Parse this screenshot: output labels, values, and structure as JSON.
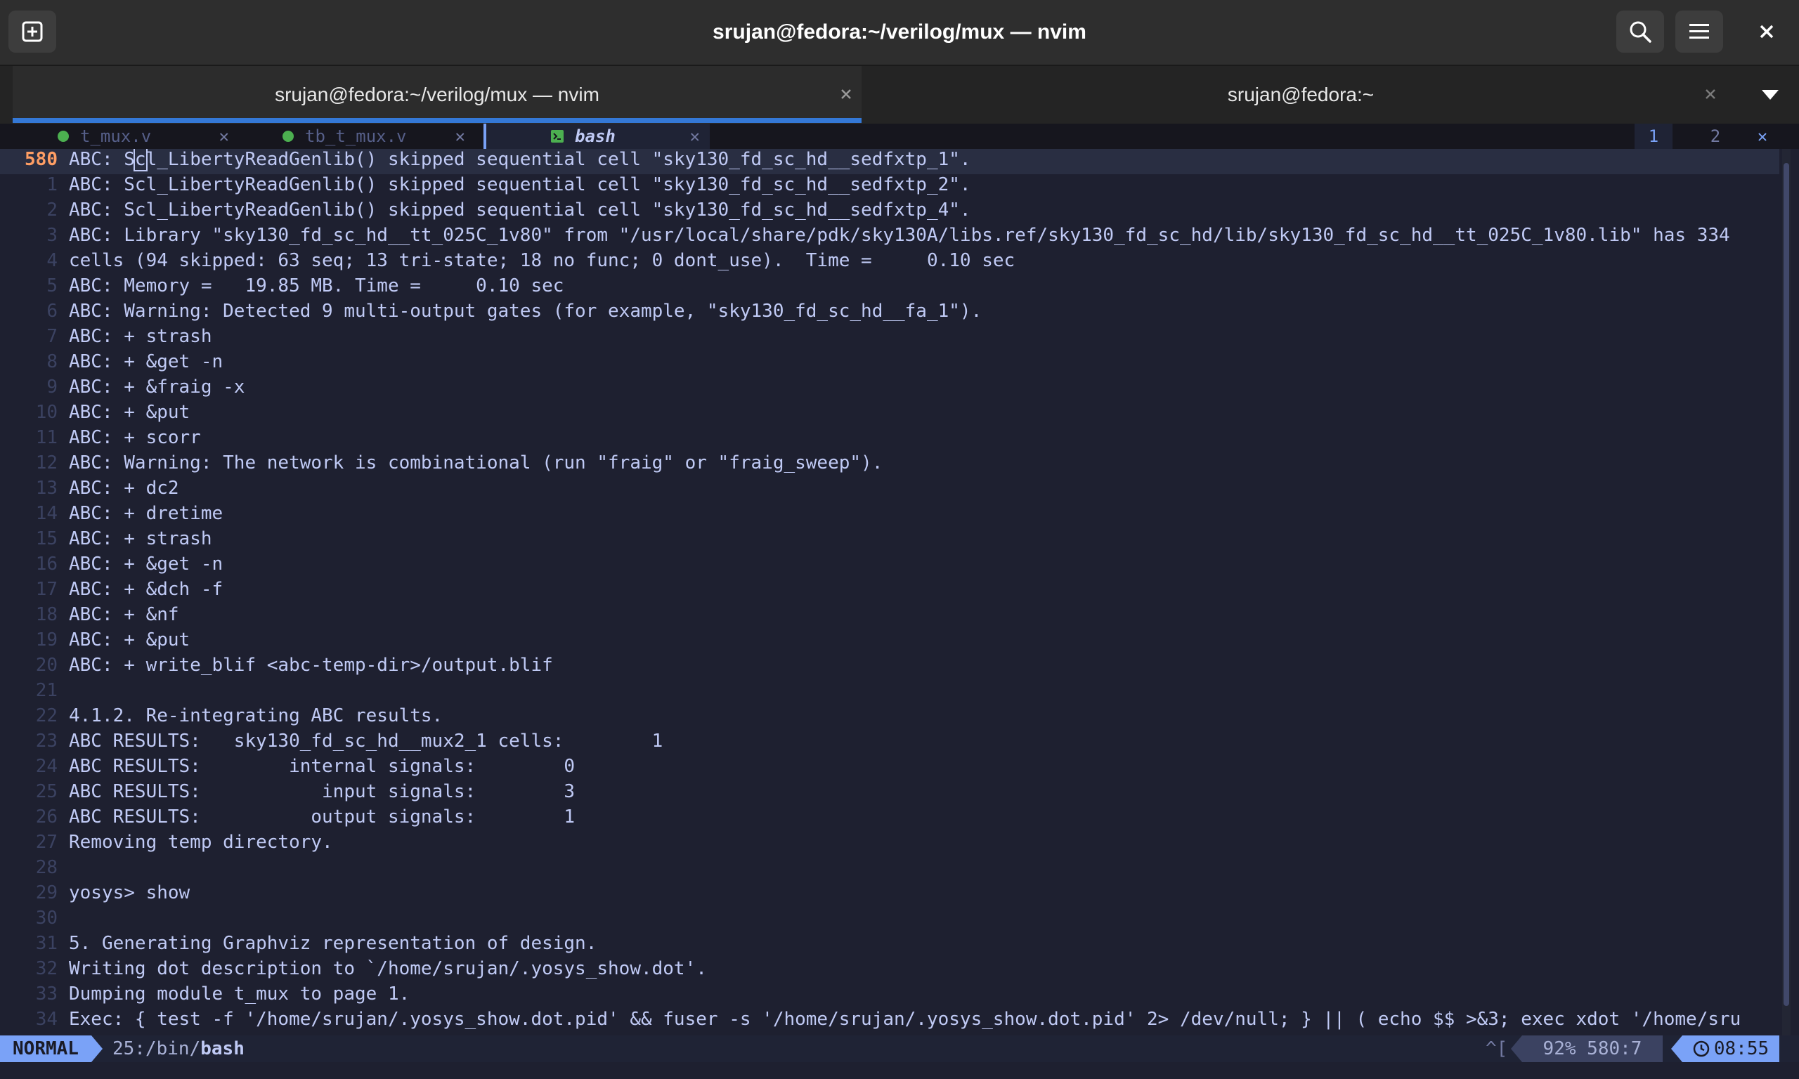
{
  "window": {
    "title": "srujan@fedora:~/verilog/mux — nvim"
  },
  "terminal_tabs": [
    {
      "label": "srujan@fedora:~/verilog/mux — nvim",
      "active": true
    },
    {
      "label": "srujan@fedora:~",
      "active": false
    }
  ],
  "vim_tabs": [
    {
      "label": "t_mux.v"
    },
    {
      "label": "tb_t_mux.v"
    },
    {
      "label": "bash"
    }
  ],
  "tab_numbers": [
    "1",
    "2"
  ],
  "tab_close_glyph": "✕",
  "editor": {
    "lines": [
      {
        "num": "580",
        "text": "ABC: Scl_LibertyReadGenlib() skipped sequential cell \"sky130_fd_sc_hd__sedfxtp_1\"."
      },
      {
        "num": "1",
        "text": "ABC: Scl_LibertyReadGenlib() skipped sequential cell \"sky130_fd_sc_hd__sedfxtp_2\"."
      },
      {
        "num": "2",
        "text": "ABC: Scl_LibertyReadGenlib() skipped sequential cell \"sky130_fd_sc_hd__sedfxtp_4\"."
      },
      {
        "num": "3",
        "text": "ABC: Library \"sky130_fd_sc_hd__tt_025C_1v80\" from \"/usr/local/share/pdk/sky130A/libs.ref/sky130_fd_sc_hd/lib/sky130_fd_sc_hd__tt_025C_1v80.lib\" has 334"
      },
      {
        "num": "4",
        "text": "cells (94 skipped: 63 seq; 13 tri-state; 18 no func; 0 dont_use).  Time =     0.10 sec"
      },
      {
        "num": "5",
        "text": "ABC: Memory =   19.85 MB. Time =     0.10 sec"
      },
      {
        "num": "6",
        "text": "ABC: Warning: Detected 9 multi-output gates (for example, \"sky130_fd_sc_hd__fa_1\")."
      },
      {
        "num": "7",
        "text": "ABC: + strash"
      },
      {
        "num": "8",
        "text": "ABC: + &get -n"
      },
      {
        "num": "9",
        "text": "ABC: + &fraig -x"
      },
      {
        "num": "10",
        "text": "ABC: + &put"
      },
      {
        "num": "11",
        "text": "ABC: + scorr"
      },
      {
        "num": "12",
        "text": "ABC: Warning: The network is combinational (run \"fraig\" or \"fraig_sweep\")."
      },
      {
        "num": "13",
        "text": "ABC: + dc2"
      },
      {
        "num": "14",
        "text": "ABC: + dretime"
      },
      {
        "num": "15",
        "text": "ABC: + strash"
      },
      {
        "num": "16",
        "text": "ABC: + &get -n"
      },
      {
        "num": "17",
        "text": "ABC: + &dch -f"
      },
      {
        "num": "18",
        "text": "ABC: + &nf"
      },
      {
        "num": "19",
        "text": "ABC: + &put"
      },
      {
        "num": "20",
        "text": "ABC: + write_blif <abc-temp-dir>/output.blif"
      },
      {
        "num": "21",
        "text": ""
      },
      {
        "num": "22",
        "text": "4.1.2. Re-integrating ABC results."
      },
      {
        "num": "23",
        "text": "ABC RESULTS:   sky130_fd_sc_hd__mux2_1 cells:        1"
      },
      {
        "num": "24",
        "text": "ABC RESULTS:        internal signals:        0"
      },
      {
        "num": "25",
        "text": "ABC RESULTS:           input signals:        3"
      },
      {
        "num": "26",
        "text": "ABC RESULTS:          output signals:        1"
      },
      {
        "num": "27",
        "text": "Removing temp directory."
      },
      {
        "num": "28",
        "text": ""
      },
      {
        "num": "29",
        "text": "yosys> show"
      },
      {
        "num": "30",
        "text": ""
      },
      {
        "num": "31",
        "text": "5. Generating Graphviz representation of design."
      },
      {
        "num": "32",
        "text": "Writing dot description to `/home/srujan/.yosys_show.dot'."
      },
      {
        "num": "33",
        "text": "Dumping module t_mux to page 1."
      },
      {
        "num": "34",
        "text": "Exec: { test -f '/home/srujan/.yosys_show.dot.pid' && fuser -s '/home/srujan/.yosys_show.dot.pid' 2> /dev/null; } || ( echo $$ >&3; exec xdot '/home/sru"
      }
    ]
  },
  "statusline": {
    "mode": "NORMAL",
    "term_prefix": "25:/bin/",
    "term_name": "bash",
    "keys": "^[",
    "position": "92% 580:7",
    "time": "08:55"
  },
  "icons": {
    "new_tab": "new-tab-icon",
    "search": "search-icon",
    "menu": "hamburger-menu-icon",
    "close": "close-icon",
    "tab_list": "chevron-down-icon",
    "clock": "clock-icon",
    "terminal": "terminal-icon"
  },
  "colors": {
    "accent_blue": "#3478d6",
    "vim_blue": "#7aa2f7",
    "line_number_current": "#ff9e64",
    "text": "#c0caf5",
    "file_icon_green": "#4caf50"
  }
}
